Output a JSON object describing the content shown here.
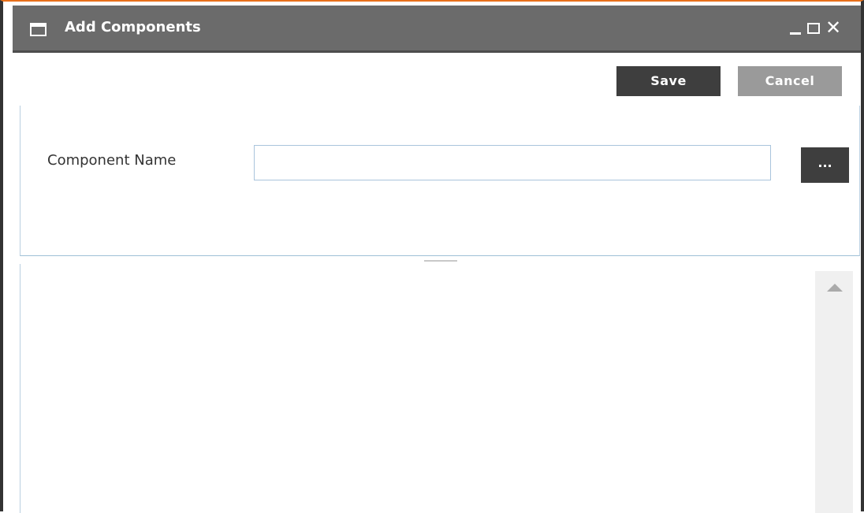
{
  "window": {
    "title": "Add Components",
    "controls": {
      "minimize_icon": "minimize-icon",
      "maximize_icon": "maximize-icon",
      "close_glyph": "✕"
    }
  },
  "toolbar": {
    "save_label": "Save",
    "cancel_label": "Cancel"
  },
  "form": {
    "component_name_label": "Component Name",
    "component_name_value": "",
    "browse_label": "..."
  },
  "colors": {
    "accent_top": "#e8701a",
    "titlebar": "#6b6b6b",
    "primary_button": "#3e3e3e",
    "disabled_button": "#9a9a9a",
    "panel_border": "#9ec0d6"
  }
}
